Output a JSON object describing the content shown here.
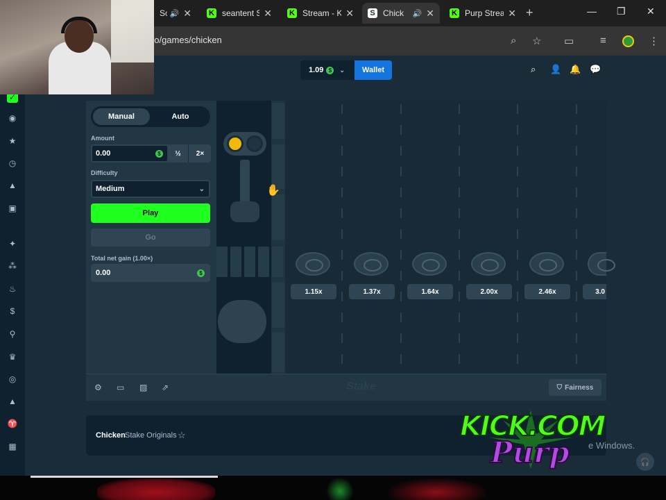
{
  "browser": {
    "tabs": [
      {
        "title": "So",
        "audio": true
      },
      {
        "title": "seantent S",
        "audio": false
      },
      {
        "title": "Stream - K",
        "audio": false
      },
      {
        "title": "Chick",
        "audio": true,
        "active": true
      },
      {
        "title": "Purp Strea",
        "audio": false
      }
    ],
    "new_tab": "+",
    "url": "no/games/chicken",
    "controls": {
      "minimize": "—",
      "maximize": "❐",
      "close": "✕"
    }
  },
  "header": {
    "balance": "1.09",
    "currency_symbol": "$",
    "wallet_label": "Wallet"
  },
  "bet_panel": {
    "mode_manual": "Manual",
    "mode_auto": "Auto",
    "amount_label": "Amount",
    "amount_value": "0.00",
    "half_label": "½",
    "double_label": "2×",
    "difficulty_label": "Difficulty",
    "difficulty_value": "Medium",
    "play_label": "Play",
    "go_label": "Go",
    "net_gain_label": "Total net gain (1.00×)",
    "net_gain_value": "0.00"
  },
  "multipliers": [
    "1.15x",
    "1.37x",
    "1.64x",
    "2.00x",
    "2.46x",
    "3.0"
  ],
  "footer": {
    "fairness_label": "Fairness",
    "watermark": "Stake"
  },
  "game_info": {
    "title": "Chicken",
    "subtitle": "Stake Originals"
  },
  "overlay": {
    "windows_text": "e Windows.",
    "kick_line1": "KICK.COM",
    "kick_line2": "Purp"
  }
}
